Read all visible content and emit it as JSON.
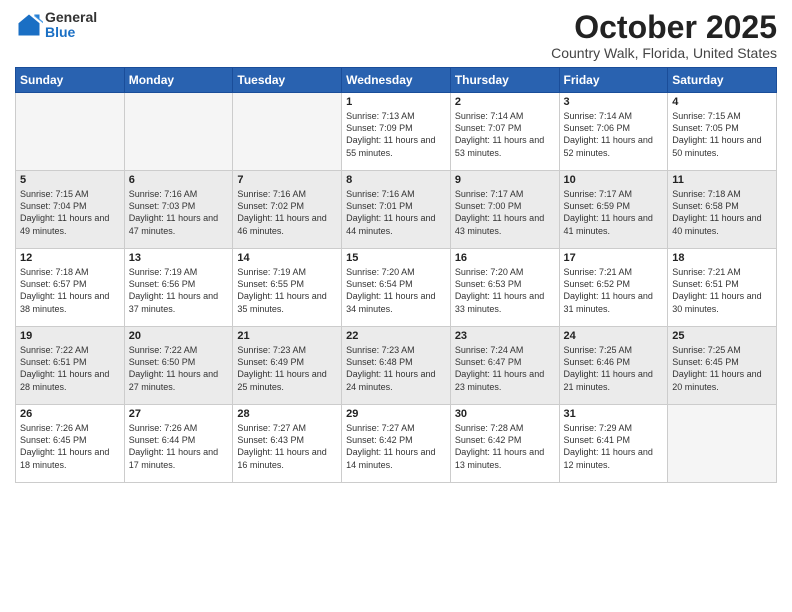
{
  "logo": {
    "general": "General",
    "blue": "Blue"
  },
  "header": {
    "month": "October 2025",
    "location": "Country Walk, Florida, United States"
  },
  "weekdays": [
    "Sunday",
    "Monday",
    "Tuesday",
    "Wednesday",
    "Thursday",
    "Friday",
    "Saturday"
  ],
  "weeks": [
    [
      {
        "day": "",
        "info": ""
      },
      {
        "day": "",
        "info": ""
      },
      {
        "day": "",
        "info": ""
      },
      {
        "day": "1",
        "info": "Sunrise: 7:13 AM\nSunset: 7:09 PM\nDaylight: 11 hours and 55 minutes."
      },
      {
        "day": "2",
        "info": "Sunrise: 7:14 AM\nSunset: 7:07 PM\nDaylight: 11 hours and 53 minutes."
      },
      {
        "day": "3",
        "info": "Sunrise: 7:14 AM\nSunset: 7:06 PM\nDaylight: 11 hours and 52 minutes."
      },
      {
        "day": "4",
        "info": "Sunrise: 7:15 AM\nSunset: 7:05 PM\nDaylight: 11 hours and 50 minutes."
      }
    ],
    [
      {
        "day": "5",
        "info": "Sunrise: 7:15 AM\nSunset: 7:04 PM\nDaylight: 11 hours and 49 minutes."
      },
      {
        "day": "6",
        "info": "Sunrise: 7:16 AM\nSunset: 7:03 PM\nDaylight: 11 hours and 47 minutes."
      },
      {
        "day": "7",
        "info": "Sunrise: 7:16 AM\nSunset: 7:02 PM\nDaylight: 11 hours and 46 minutes."
      },
      {
        "day": "8",
        "info": "Sunrise: 7:16 AM\nSunset: 7:01 PM\nDaylight: 11 hours and 44 minutes."
      },
      {
        "day": "9",
        "info": "Sunrise: 7:17 AM\nSunset: 7:00 PM\nDaylight: 11 hours and 43 minutes."
      },
      {
        "day": "10",
        "info": "Sunrise: 7:17 AM\nSunset: 6:59 PM\nDaylight: 11 hours and 41 minutes."
      },
      {
        "day": "11",
        "info": "Sunrise: 7:18 AM\nSunset: 6:58 PM\nDaylight: 11 hours and 40 minutes."
      }
    ],
    [
      {
        "day": "12",
        "info": "Sunrise: 7:18 AM\nSunset: 6:57 PM\nDaylight: 11 hours and 38 minutes."
      },
      {
        "day": "13",
        "info": "Sunrise: 7:19 AM\nSunset: 6:56 PM\nDaylight: 11 hours and 37 minutes."
      },
      {
        "day": "14",
        "info": "Sunrise: 7:19 AM\nSunset: 6:55 PM\nDaylight: 11 hours and 35 minutes."
      },
      {
        "day": "15",
        "info": "Sunrise: 7:20 AM\nSunset: 6:54 PM\nDaylight: 11 hours and 34 minutes."
      },
      {
        "day": "16",
        "info": "Sunrise: 7:20 AM\nSunset: 6:53 PM\nDaylight: 11 hours and 33 minutes."
      },
      {
        "day": "17",
        "info": "Sunrise: 7:21 AM\nSunset: 6:52 PM\nDaylight: 11 hours and 31 minutes."
      },
      {
        "day": "18",
        "info": "Sunrise: 7:21 AM\nSunset: 6:51 PM\nDaylight: 11 hours and 30 minutes."
      }
    ],
    [
      {
        "day": "19",
        "info": "Sunrise: 7:22 AM\nSunset: 6:51 PM\nDaylight: 11 hours and 28 minutes."
      },
      {
        "day": "20",
        "info": "Sunrise: 7:22 AM\nSunset: 6:50 PM\nDaylight: 11 hours and 27 minutes."
      },
      {
        "day": "21",
        "info": "Sunrise: 7:23 AM\nSunset: 6:49 PM\nDaylight: 11 hours and 25 minutes."
      },
      {
        "day": "22",
        "info": "Sunrise: 7:23 AM\nSunset: 6:48 PM\nDaylight: 11 hours and 24 minutes."
      },
      {
        "day": "23",
        "info": "Sunrise: 7:24 AM\nSunset: 6:47 PM\nDaylight: 11 hours and 23 minutes."
      },
      {
        "day": "24",
        "info": "Sunrise: 7:25 AM\nSunset: 6:46 PM\nDaylight: 11 hours and 21 minutes."
      },
      {
        "day": "25",
        "info": "Sunrise: 7:25 AM\nSunset: 6:45 PM\nDaylight: 11 hours and 20 minutes."
      }
    ],
    [
      {
        "day": "26",
        "info": "Sunrise: 7:26 AM\nSunset: 6:45 PM\nDaylight: 11 hours and 18 minutes."
      },
      {
        "day": "27",
        "info": "Sunrise: 7:26 AM\nSunset: 6:44 PM\nDaylight: 11 hours and 17 minutes."
      },
      {
        "day": "28",
        "info": "Sunrise: 7:27 AM\nSunset: 6:43 PM\nDaylight: 11 hours and 16 minutes."
      },
      {
        "day": "29",
        "info": "Sunrise: 7:27 AM\nSunset: 6:42 PM\nDaylight: 11 hours and 14 minutes."
      },
      {
        "day": "30",
        "info": "Sunrise: 7:28 AM\nSunset: 6:42 PM\nDaylight: 11 hours and 13 minutes."
      },
      {
        "day": "31",
        "info": "Sunrise: 7:29 AM\nSunset: 6:41 PM\nDaylight: 11 hours and 12 minutes."
      },
      {
        "day": "",
        "info": ""
      }
    ]
  ]
}
